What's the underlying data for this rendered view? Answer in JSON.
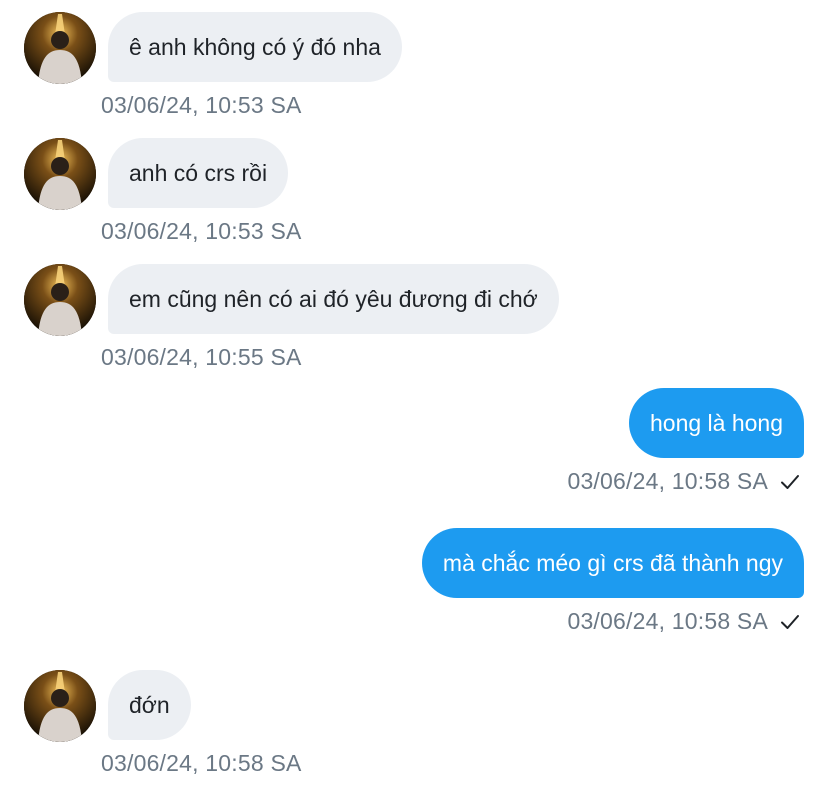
{
  "messages": [
    {
      "direction": "in",
      "text": "ê anh không có ý đó nha",
      "time": "03/06/24, 10:53 SA"
    },
    {
      "direction": "in",
      "text": "anh có crs rồi",
      "time": "03/06/24, 10:53 SA"
    },
    {
      "direction": "in",
      "text": "em cũng nên có ai đó yêu đương đi chớ",
      "time": "03/06/24, 10:55 SA"
    },
    {
      "direction": "out",
      "text": "hong là hong",
      "time": "03/06/24, 10:58 SA",
      "status_icon": "check-icon"
    },
    {
      "direction": "out",
      "text": "mà chắc méo gì crs đã thành ngy",
      "time": "03/06/24, 10:58 SA",
      "status_icon": "check-icon"
    },
    {
      "direction": "in",
      "text": "đớn",
      "time": "03/06/24, 10:58 SA"
    }
  ],
  "colors": {
    "incoming_bubble": "#eceff3",
    "outgoing_bubble": "#1d9bf0",
    "timestamp": "#6b7885"
  },
  "icons": {
    "avatar": "user-avatar-photo",
    "read_status": "check-icon"
  }
}
